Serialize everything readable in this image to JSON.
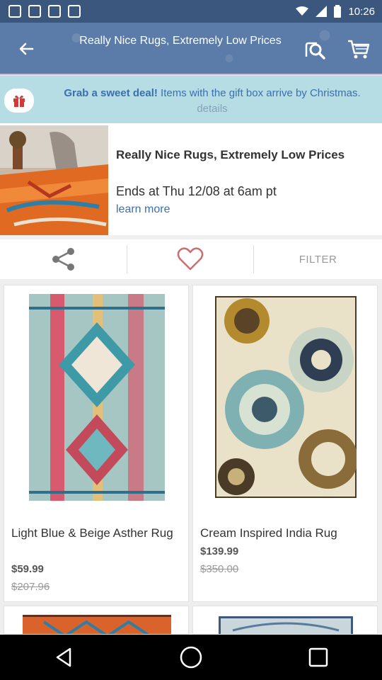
{
  "status_bar": {
    "time": "10:26"
  },
  "header": {
    "title": "Really Nice Rugs, Extremely Low Prices",
    "colors": {
      "bar": "#5b7ba8",
      "status": "#3c577d"
    }
  },
  "promo": {
    "bold": "Grab a sweet deal!",
    "rest": " Items with the gift box arrive by Christmas.",
    "details": "details"
  },
  "event": {
    "title": "Really Nice Rugs, Extremely Low Prices",
    "ends": "Ends at Thu 12/08 at 6am pt",
    "learn_more": "learn more"
  },
  "actions": {
    "filter_label": "FILTER"
  },
  "products": [
    {
      "name": "Light Blue & Beige Asther Rug",
      "price": "$59.99",
      "original_price": "$207.96"
    },
    {
      "name": "Cream Inspired India Rug",
      "price": "$139.99",
      "original_price": "$350.00"
    }
  ],
  "icons": [
    "back-arrow-icon",
    "search-icon",
    "cart-icon",
    "gift-icon",
    "share-icon",
    "heart-icon",
    "nav-back-icon",
    "nav-home-icon",
    "nav-recents-icon"
  ]
}
